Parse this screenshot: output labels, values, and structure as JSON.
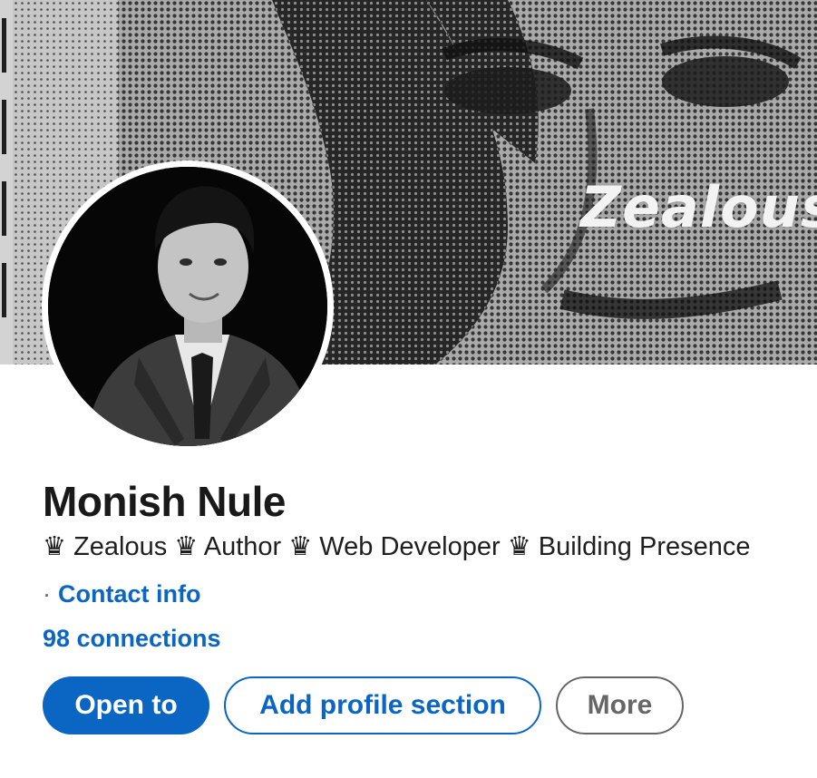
{
  "banner": {
    "text": "Zealous"
  },
  "profile": {
    "name": "Monish Nule",
    "headline": "♛ Zealous ♛ Author ♛ Web Developer ♛ Building Presence",
    "contact_separator": "·",
    "contact_label": "Contact info",
    "connections_label": "98 connections"
  },
  "actions": {
    "open_to_label": "Open to",
    "add_section_label": "Add profile section",
    "more_label": "More"
  },
  "colors": {
    "link": "#0a66c2",
    "primary_button": "#0a66c2",
    "text": "#191919",
    "secondary_text": "#666666"
  }
}
